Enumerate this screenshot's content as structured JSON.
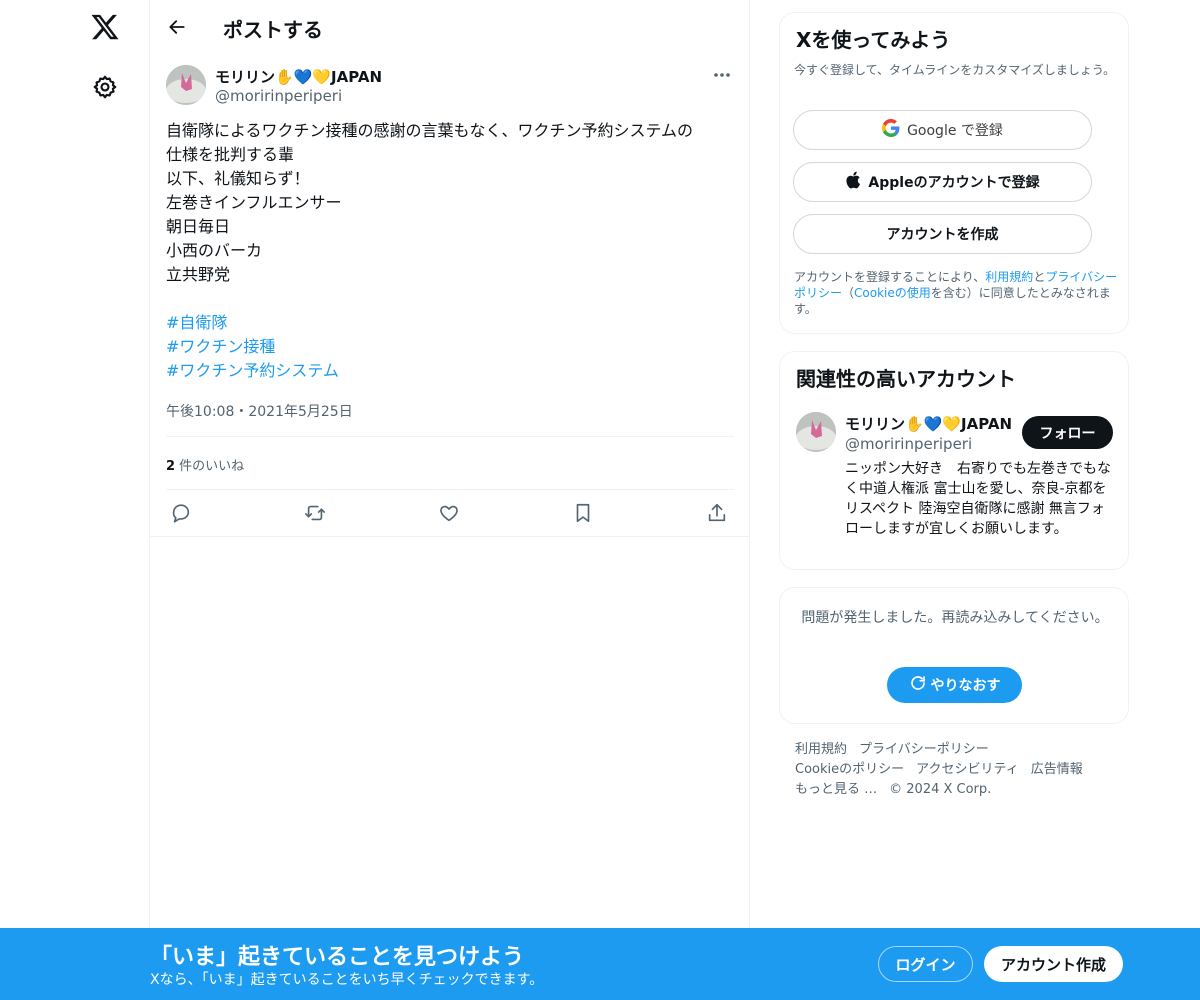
{
  "nav": {
    "logo_icon": "x-logo-icon",
    "settings_icon": "gear-icon"
  },
  "header": {
    "title": "ポストする"
  },
  "post": {
    "author_name": "モリリン✋💙💛JAPAN",
    "author_handle": "@moririnperiperi",
    "lines": [
      "自衛隊によるワクチン接種の感謝の言葉もなく、ワクチン予約システムの",
      "仕様を批判する輩",
      "以下、礼儀知らず！",
      "左巻きインフルエンサー",
      "朝日毎日",
      "小西のバーカ",
      "立共野党",
      ""
    ],
    "hashtags": [
      "#自衛隊",
      "#ワクチン接種",
      "#ワクチン予約システム"
    ],
    "timestamp": "午後10:08・2021年5月25日",
    "likes_count": "2",
    "likes_label": " 件のいいね"
  },
  "signup_card": {
    "title": "Xを使ってみよう",
    "subtitle": "今すぐ登録して、タイムラインをカスタマイズしましょう。",
    "google_label": "Google で登録",
    "apple_label": "Appleのアカウントで登録",
    "create_label": "アカウントを作成",
    "terms_prefix": "アカウントを登録することにより、",
    "terms_link1": "利用規約",
    "terms_and": "と",
    "terms_link2": "プライバシーポリシー",
    "terms_mid": "（",
    "terms_link3": "Cookieの使用",
    "terms_suffix": "を含む）に同意したとみなされます。"
  },
  "related_card": {
    "title": "関連性の高いアカウント",
    "name": "モリリン✋💙💛JAPAN",
    "handle": "@moririnperiperi",
    "follow_label": "フォロー",
    "bio": "ニッポン大好き　右寄りでも左巻きでもなく中道人権派 富士山を愛し、奈良-京都をリスペクト 陸海空自衛隊に感謝 無言フォローしますが宜しくお願いします。"
  },
  "error_card": {
    "message": "問題が発生しました。再読み込みしてください。",
    "retry_label": "やりなおす"
  },
  "footer": {
    "links": [
      "利用規約",
      "プライバシーポリシー",
      "Cookieのポリシー",
      "アクセシビリティ",
      "広告情報",
      "もっと見る …",
      "© 2024 X Corp."
    ]
  },
  "bottom_bar": {
    "title": "「いま」起きていることを見つけよう",
    "subtitle": "Xなら、「いま」起きていることをいち早くチェックできます。",
    "login_label": "ログイン",
    "signup_label": "アカウント作成"
  },
  "colors": {
    "accent": "#1d9bf0",
    "text": "#0f1419",
    "muted": "#536471"
  }
}
